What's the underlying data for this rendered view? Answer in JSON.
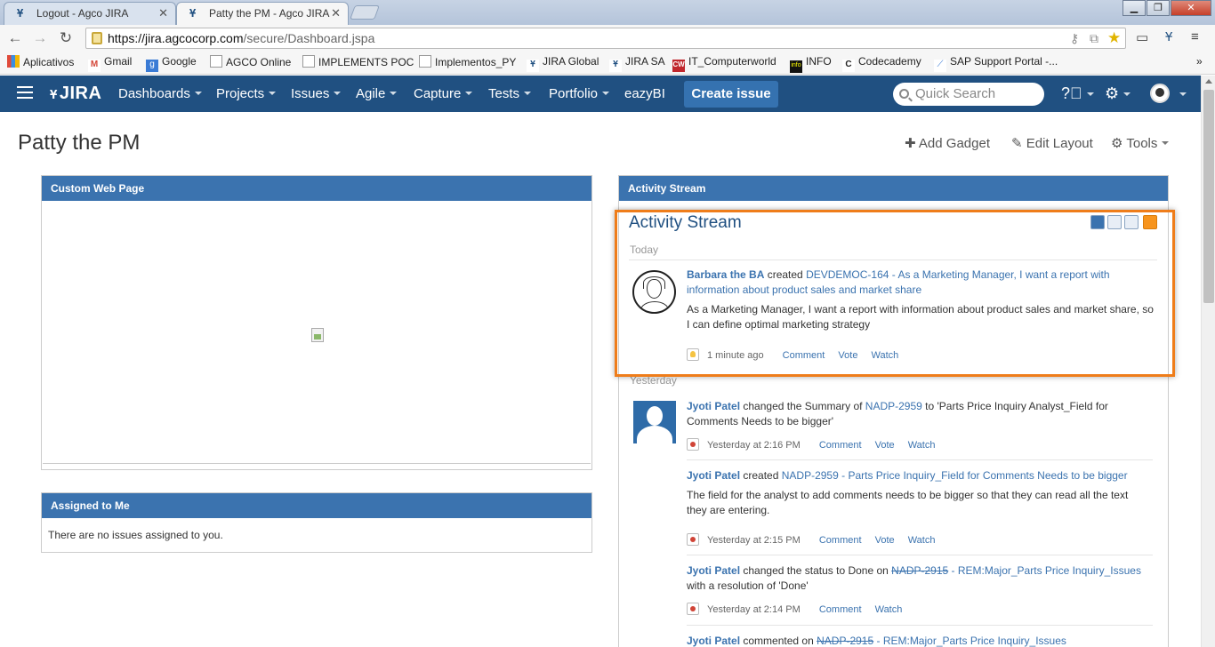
{
  "browser": {
    "tabs": [
      {
        "title": "Logout - Agco JIRA",
        "active": false
      },
      {
        "title": "Patty the PM - Agco JIRA",
        "active": true
      }
    ],
    "url_host": "https://jira.agcocorp.com",
    "url_path": "/secure/Dashboard.jspa",
    "bookmarks": [
      "Aplicativos",
      "Gmail",
      "Google",
      "AGCO Online",
      "IMPLEMENTS POC",
      "Implementos_PY",
      "JIRA Global",
      "JIRA SA",
      "IT_Computerworld",
      "INFO",
      "Codecademy",
      "SAP Support Portal -..."
    ],
    "bookmarks_more": "»"
  },
  "header": {
    "logo": "JIRA",
    "nav": [
      "Dashboards",
      "Projects",
      "Issues",
      "Agile",
      "Capture",
      "Tests",
      "Portfolio",
      "eazyBI"
    ],
    "create_label": "Create issue",
    "search_placeholder": "Quick Search"
  },
  "dashboard": {
    "title": "Patty the PM",
    "tools": {
      "add_gadget": "Add Gadget",
      "edit_layout": "Edit Layout",
      "tools": "Tools"
    }
  },
  "gadgets": {
    "custom_web_page": {
      "title": "Custom Web Page"
    },
    "assigned": {
      "title": "Assigned to Me",
      "empty": "There are no issues assigned to you."
    },
    "activity": {
      "header": "Activity Stream",
      "title": "Activity Stream",
      "today_label": "Today",
      "yesterday_label": "Yesterday",
      "entries": [
        {
          "user": "Barbara the BA",
          "verb": "created",
          "link": "DEVDEMOC-164 - As a Marketing Manager, I want a report with information about product sales and market share",
          "desc": "As a Marketing Manager, I want a report with information about product sales and market share, so I can define optimal marketing strategy",
          "time": "1 minute ago",
          "actions": [
            "Comment",
            "Vote",
            "Watch"
          ]
        },
        {
          "user": "Jyoti Patel",
          "verb": "changed the Summary of",
          "link": "NADP-2959",
          "tail": "to 'Parts Price Inquiry Analyst_Field for Comments Needs to be bigger'",
          "time": "Yesterday at 2:16 PM",
          "actions": [
            "Comment",
            "Vote",
            "Watch"
          ]
        },
        {
          "user": "Jyoti Patel",
          "verb": "created",
          "link": "NADP-2959 - Parts Price Inquiry_Field for Comments Needs to be bigger",
          "desc": "The field for the analyst to add comments needs to be bigger so that they can read all the text they are entering.",
          "time": "Yesterday at 2:15 PM",
          "actions": [
            "Comment",
            "Vote",
            "Watch"
          ]
        },
        {
          "user": "Jyoti Patel",
          "verb": "changed the status to Done on",
          "strike": "NADP-2915",
          "link": "- REM:Major_Parts Price Inquiry_Issues",
          "tail": "with a resolution of 'Done'",
          "time": "Yesterday at 2:14 PM",
          "actions": [
            "Comment",
            "Watch"
          ]
        },
        {
          "user": "Jyoti Patel",
          "verb": "commented on",
          "strike": "NADP-2915",
          "link": "- REM:Major_Parts Price Inquiry_Issues"
        }
      ]
    }
  },
  "colors": {
    "header": "#205081",
    "gadget_head": "#3b73af",
    "highlight": "#ef7d1a",
    "link": "#3b73af"
  }
}
